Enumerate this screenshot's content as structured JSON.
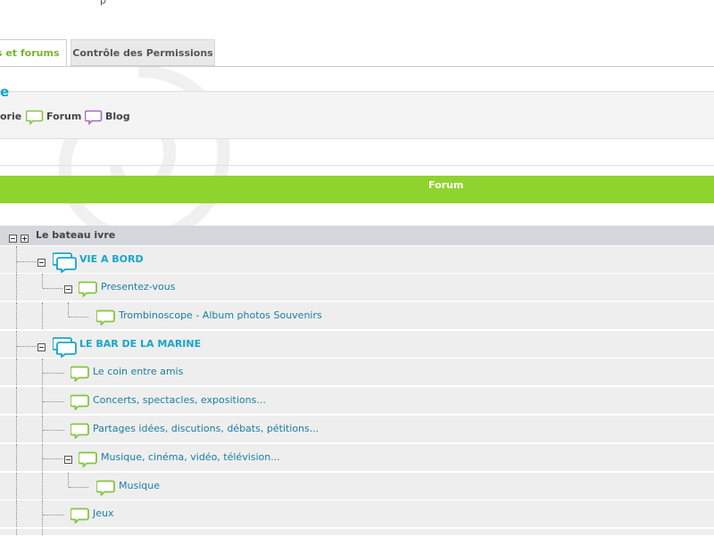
{
  "top_note": "p",
  "tabs": [
    {
      "label": "es et forums",
      "active": true
    },
    {
      "label": "Contrôle des Permissions",
      "active": false
    }
  ],
  "panel": {
    "title": "e",
    "legend": [
      {
        "label": "orie",
        "icon": "category-icon"
      },
      {
        "label": "Forum",
        "icon": "forum-icon"
      },
      {
        "label": "Blog",
        "icon": "blog-icon"
      }
    ]
  },
  "table": {
    "header": "Forum"
  },
  "tree": {
    "root": {
      "label": "Le bateau ivre"
    },
    "items": [
      {
        "label": "VIE A BORD",
        "type": "category"
      },
      {
        "label": "Presentez-vous",
        "type": "forum"
      },
      {
        "label": "Trombinoscope - Album photos Souvenirs",
        "type": "forum"
      },
      {
        "label": "LE BAR DE LA MARINE",
        "type": "category"
      },
      {
        "label": "Le coin entre amis",
        "type": "forum"
      },
      {
        "label": "Concerts, spectacles, expositions...",
        "type": "forum"
      },
      {
        "label": "Partages idées, discutions, débats, pétitions...",
        "type": "forum"
      },
      {
        "label": "Musique, cinéma, vidéo, télévision...",
        "type": "forum"
      },
      {
        "label": "Musique",
        "type": "forum"
      },
      {
        "label": "Jeux",
        "type": "forum"
      }
    ]
  },
  "colors": {
    "accent_green": "#8fd42e",
    "link_blue": "#17a6c9",
    "blog_purple": "#a46bbd",
    "forum_green": "#86c540"
  }
}
